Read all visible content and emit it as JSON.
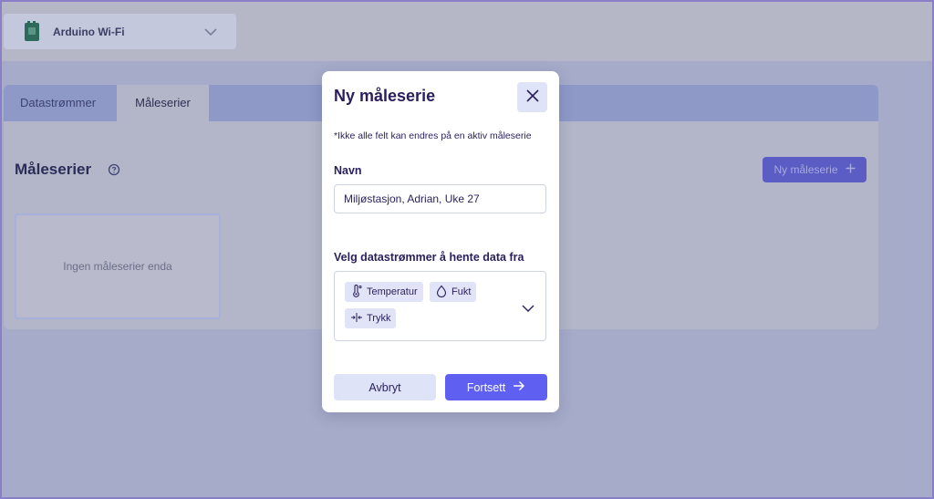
{
  "topbar": {
    "device_name": "Arduino Wi-Fi",
    "device_icon": "arduino-board-icon",
    "chevron_icon": "chevron-down-icon"
  },
  "tabs": [
    {
      "label": "Datastrømmer",
      "active": false
    },
    {
      "label": "Måleserier",
      "active": true
    }
  ],
  "page": {
    "title": "Måleserier",
    "help_icon": "question-circle-icon",
    "new_button_label": "Ny måleserie",
    "new_button_icon": "plus-icon",
    "empty_text": "Ingen måleserier enda"
  },
  "modal": {
    "title": "Ny måleserie",
    "close_icon": "close-icon",
    "note": "*Ikke alle felt kan endres på en aktiv måleserie",
    "name_label": "Navn",
    "name_value": "Miljøstasjon, Adrian, Uke 27",
    "streams_label": "Velg datastrømmer å hente data fra",
    "selected_streams": [
      {
        "label": "Temperatur",
        "icon": "thermometer-icon"
      },
      {
        "label": "Fukt",
        "icon": "droplet-icon"
      },
      {
        "label": "Trykk",
        "icon": "pressure-icon"
      }
    ],
    "cancel_label": "Avbryt",
    "continue_label": "Fortsett",
    "continue_icon": "arrow-right-icon"
  },
  "colors": {
    "accent": "#5f5ff2",
    "text_dark": "#2a1f5c",
    "chip_bg": "#e1e4f7",
    "overlay": "#a5abc9"
  }
}
